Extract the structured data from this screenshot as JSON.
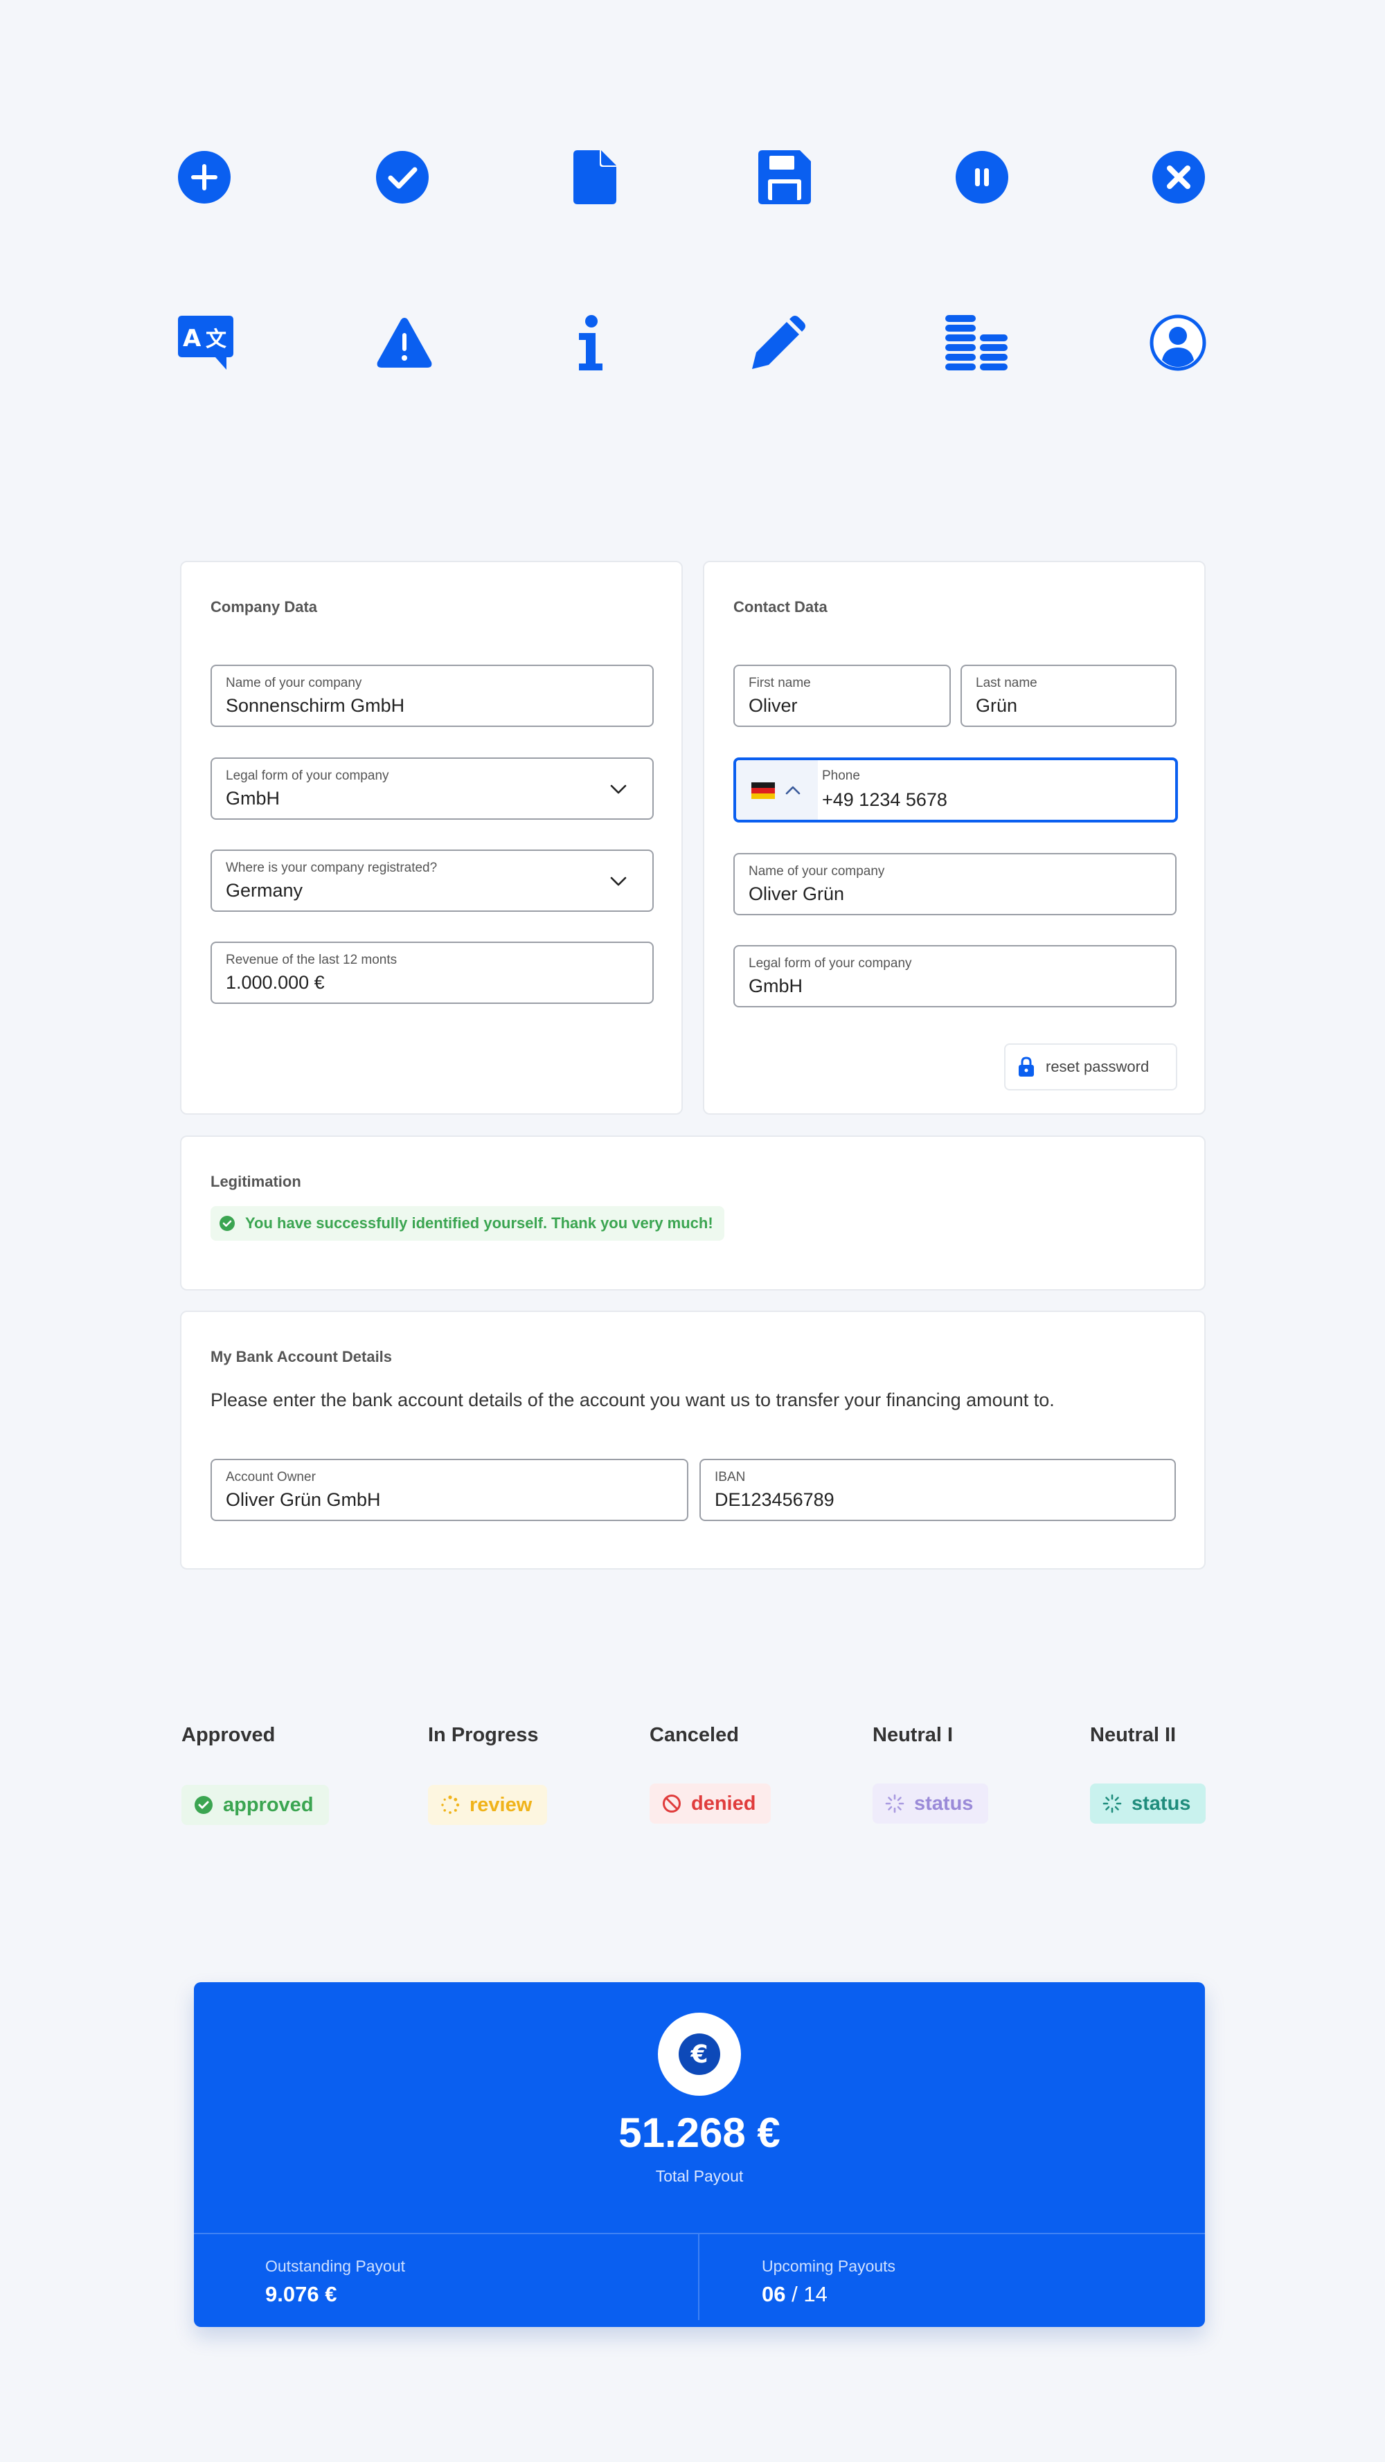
{
  "icons": {
    "row1": [
      "plus-circle-icon",
      "check-circle-icon",
      "file-icon",
      "floppy-disk-icon",
      "pause-circle-icon",
      "close-circle-icon"
    ],
    "row2": [
      "translate-icon",
      "warning-icon",
      "info-icon",
      "pencil-icon",
      "list-stack-icon",
      "user-circle-icon"
    ],
    "color": "#0a5ff0"
  },
  "company": {
    "title": "Company Data",
    "fields": [
      {
        "label": "Name of your company",
        "value": "Sonnenschirm GmbH"
      },
      {
        "label": "Legal form of your company",
        "value": "GmbH"
      },
      {
        "label": "Where is your company registrated?",
        "value": "Germany"
      },
      {
        "label": "Revenue of the last 12 monts",
        "value": "1.000.000 €"
      }
    ]
  },
  "contact": {
    "title": "Contact Data",
    "first_name": {
      "label": "First name",
      "value": "Oliver"
    },
    "last_name": {
      "label": "Last name",
      "value": "Grün"
    },
    "phone": {
      "label": "Phone",
      "value": "+49 1234 5678",
      "country_flag": "germany-flag-icon"
    },
    "company_name": {
      "label": "Name of your company",
      "value": "Oliver Grün"
    },
    "legal_form": {
      "label": "Legal form of your company",
      "value": "GmbH"
    },
    "reset_button": "reset password"
  },
  "legitimation": {
    "title": "Legitimation",
    "message": "You have successfully identified yourself. Thank you very much!"
  },
  "bank": {
    "title": "My Bank Account Details",
    "description": "Please enter the bank account details of the account you want us to transfer your financing amount to.",
    "owner": {
      "label": "Account Owner",
      "value": "Oliver Grün GmbH"
    },
    "iban": {
      "label": "IBAN",
      "value": "DE123456789"
    }
  },
  "statuses": [
    {
      "title": "Approved",
      "badge": "approved",
      "color": "#3ba551",
      "bg": "#eaf7ec"
    },
    {
      "title": "In Progress",
      "badge": "review",
      "color": "#f0b31a",
      "bg": "#fdf6e0"
    },
    {
      "title": "Canceled",
      "badge": "denied",
      "color": "#e03c3c",
      "bg": "#fdecec"
    },
    {
      "title": "Neutral I",
      "badge": "status",
      "color": "#9a8ad8",
      "bg": "#efecfb"
    },
    {
      "title": "Neutral II",
      "badge": "status",
      "color": "#1f8c7c",
      "bg": "#c9f2ee"
    }
  ],
  "payout": {
    "amount": "51.268 €",
    "amount_label": "Total Payout",
    "outstanding_label": "Outstanding Payout",
    "outstanding_value": "9.076 €",
    "upcoming_label": "Upcoming Payouts",
    "upcoming_current": "06",
    "upcoming_total": "/ 14",
    "bg": "#0a5ff0"
  }
}
